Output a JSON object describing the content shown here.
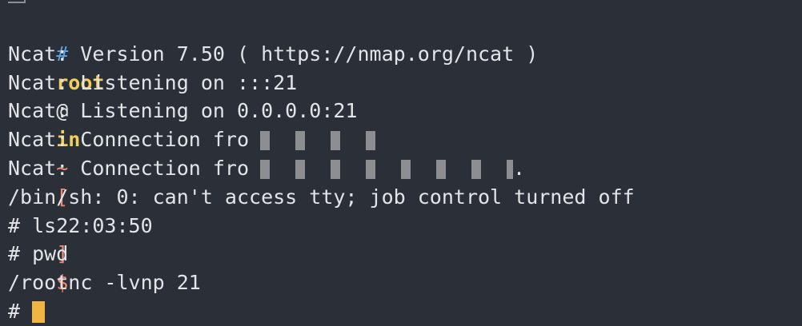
{
  "prompt": {
    "hash": "#",
    "user": "root",
    "at": "@",
    "host": "in",
    "tilde": "~",
    "lbracket": "[",
    "time": "22:03:50",
    "rbracket": "]",
    "dollar": "$",
    "command": "nc -lvnp 21"
  },
  "output": {
    "version": "Ncat: Version 7.50 ( https://nmap.org/ncat )",
    "listen_ipv6": "Ncat: Listening on :::21",
    "listen_ipv4_prefix": "Ncat: Listening on 0.",
    "listen_ipv4_blur": "0.0.0:21",
    "conn1_prefix": "Ncat: Connection fro",
    "conn2_prefix": "Ncat: Connection fro",
    "conn2_suffix": ".",
    "shell_warning": "/bin/sh: 0: can't access tty; job control turned off",
    "ls_cmd": "# ls",
    "pwd_cmd": "# pwd",
    "pwd_result": "/root",
    "final_prompt": "# "
  },
  "colors": {
    "background": "#2b3038",
    "text": "#e2e4e8",
    "hash": "#5aa5e8",
    "user_host": "#f1cf58",
    "accent": "#ef8c76",
    "cursor": "#f0b542"
  }
}
